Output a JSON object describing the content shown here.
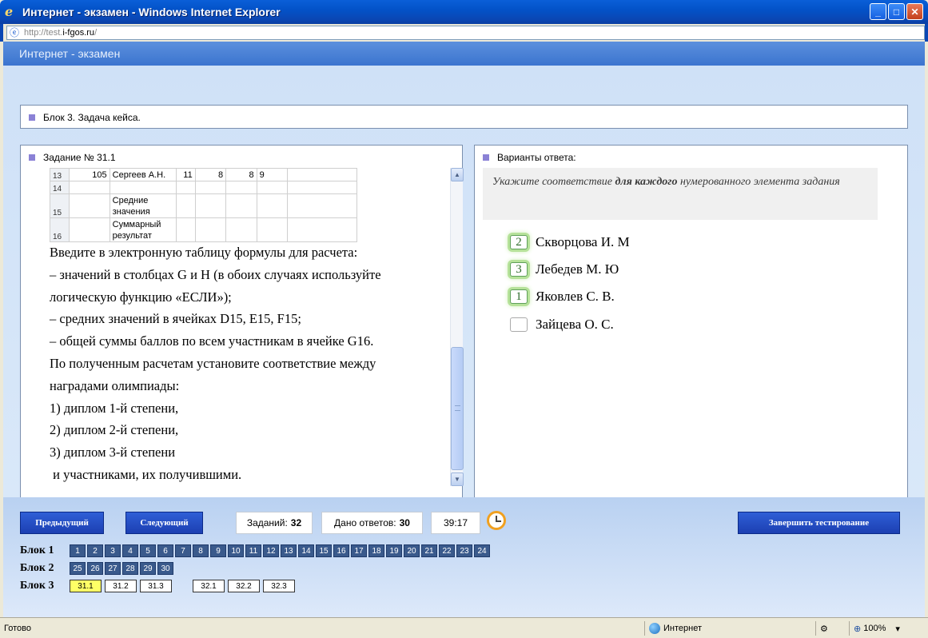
{
  "window": {
    "title": "Интернет - экзамен - Windows Internet Explorer",
    "url_prefix": "http://test.",
    "url_domain": "i-fgos.ru",
    "url_suffix": "/"
  },
  "app": {
    "header": "Интернет - экзамен",
    "block_title": "Блок 3. Задача кейса."
  },
  "task": {
    "title": "Задание № 31.1",
    "sheet_rows": [
      {
        "rn": "13",
        "c1": "105",
        "c2": "Сергеев А.Н.",
        "c3": "11",
        "c4": "8",
        "c5": "8",
        "c6": "9",
        "c7": ""
      },
      {
        "rn": "14",
        "c1": "",
        "c2": "",
        "c3": "",
        "c4": "",
        "c5": "",
        "c6": "",
        "c7": ""
      },
      {
        "rn": "15",
        "c1": "",
        "c2": "Средние значения",
        "c3": "",
        "c4": "",
        "c5": "",
        "c6": "",
        "c7": ""
      },
      {
        "rn": "16",
        "c1": "",
        "c2": "Суммарный результат",
        "c3": "",
        "c4": "",
        "c5": "",
        "c6": "",
        "c7": ""
      }
    ],
    "lines": [
      "Введите в электронную таблицу формулы для расчета:",
      "– значений в столбцах G  и H (в обоих случаях используйте",
      "логическую функцию «ЕСЛИ»);",
      "– средних значений в ячейках D15, E15, F15;",
      "– общей суммы баллов по всем участникам в ячейке G16.",
      "По полученным расчетам установите соответствие между",
      "наградами олимпиады:",
      "1) диплом 1-й степени,",
      "2) диплом 2-й степени,",
      "3) диплом 3-й степени",
      " и участниками, их получившими."
    ]
  },
  "answers": {
    "title": "Варианты ответа:",
    "instruction_pre": "Укажите соответствие ",
    "instruction_bold": "для каждого",
    "instruction_post": " нумерованного элемента задания",
    "options": [
      {
        "value": "2",
        "label": "Скворцова И. М"
      },
      {
        "value": "3",
        "label": "Лебедев М. Ю"
      },
      {
        "value": "1",
        "label": "Яковлев С. В."
      },
      {
        "value": "",
        "label": "Зайцева О. С."
      }
    ]
  },
  "footer": {
    "prev_label": "Предыдущий",
    "next_label": "Следующий",
    "tasks_label": "Заданий:",
    "tasks_value": "32",
    "answered_label": "Дано ответов:",
    "answered_value": "30",
    "timer": "39:17",
    "finish_label": "Завершить тестирование",
    "blocks": [
      {
        "label": "Блок 1",
        "items": [
          "1",
          "2",
          "3",
          "4",
          "5",
          "6",
          "7",
          "8",
          "9",
          "10",
          "11",
          "12",
          "13",
          "14",
          "15",
          "16",
          "17",
          "18",
          "19",
          "20",
          "21",
          "22",
          "23",
          "24"
        ]
      },
      {
        "label": "Блок 2",
        "items": [
          "25",
          "26",
          "27",
          "28",
          "29",
          "30"
        ]
      },
      {
        "label": "Блок 3",
        "items_a": [
          "31.1",
          "31.2",
          "31.3"
        ],
        "items_b": [
          "32.1",
          "32.2",
          "32.3"
        ],
        "current": "31.1"
      }
    ]
  },
  "statusbar": {
    "status": "Готово",
    "zone": "Интернет",
    "zoom": "100%"
  }
}
